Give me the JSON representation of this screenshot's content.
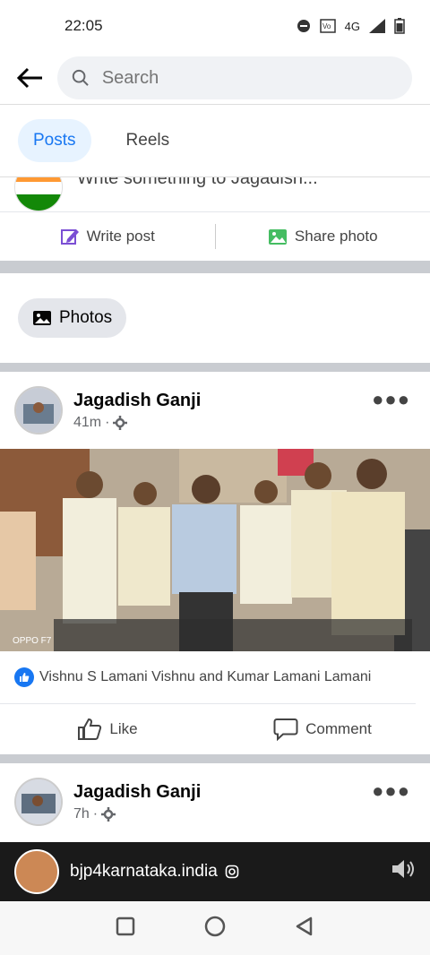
{
  "status": {
    "time": "22:05",
    "network": "4G"
  },
  "search": {
    "placeholder": "Search"
  },
  "tabs": [
    {
      "label": "Posts"
    },
    {
      "label": "Reels"
    }
  ],
  "composer": {
    "prompt": "Write something to Jagadish...",
    "write_post": "Write post",
    "share_photo": "Share photo"
  },
  "photos_chip": {
    "label": "Photos"
  },
  "posts": [
    {
      "author": "Jagadish Ganji",
      "time": "41m",
      "photo_caption": "OPPO F7",
      "reactions": "Vishnu S Lamani Vishnu and Kumar Lamani Lamani",
      "like": "Like",
      "comment": "Comment"
    },
    {
      "author": "Jagadish Ganji",
      "time": "7h",
      "video_account": "bjp4karnataka.india"
    }
  ],
  "colors": {
    "accent": "#1877f2",
    "divider": "#c9ccd1"
  }
}
